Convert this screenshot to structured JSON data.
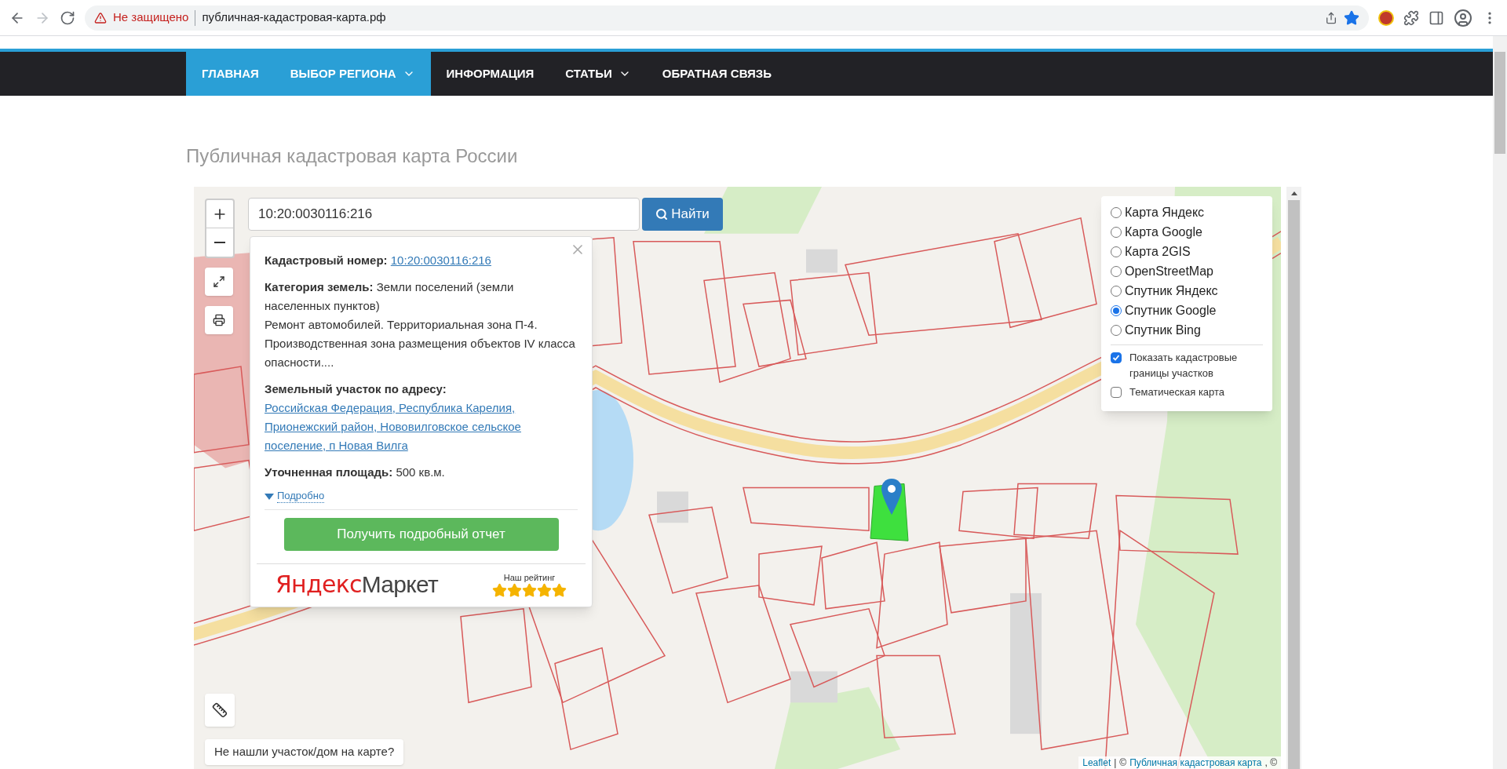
{
  "browser": {
    "security_label": "Не защищено",
    "url": "публичная-кадастровая-карта.рф",
    "bookmarked": true
  },
  "nav": [
    {
      "label": "ГЛАВНАЯ",
      "highlighted": true,
      "dropdown": false
    },
    {
      "label": "ВЫБОР РЕГИОНА",
      "highlighted": true,
      "dropdown": true
    },
    {
      "label": "ИНФОРМАЦИЯ",
      "highlighted": false,
      "dropdown": false
    },
    {
      "label": "СТАТЬИ",
      "highlighted": false,
      "dropdown": true
    },
    {
      "label": "ОБРАТНАЯ СВЯЗЬ",
      "highlighted": false,
      "dropdown": false
    }
  ],
  "page_title": "Публичная кадастровая карта России",
  "map": {
    "search": {
      "value": "10:20:0030116:216",
      "button": "Найти"
    },
    "popup": {
      "cadastral_label": "Кадастровый номер:",
      "cadastral_link": "10:20:0030116:216",
      "category": "**Категория земель:** Земли поселений (земли населенных пунктов)",
      "description": "Ремонт автомобилей. Территориальная зона П-4. Производственная зона размещения объектов IV класса опасности....",
      "address_label": "Земельный участок по адресу:",
      "address_link": "Российская Федерация, Республика Карелия, Прионежский район, Нововилговское сельское поселение, п Новая Вилга",
      "area": "**Уточненная площадь:** 500 кв.м.",
      "details": {
        "label": "Подробно",
        "expanded": false
      },
      "report_button": "Получить подробный отчет",
      "logo": {
        "part_1": "Яндекс",
        "part_2": "Маркет"
      },
      "rating": {
        "label": "Наш рейтинг",
        "stars": 5
      }
    },
    "layers": [
      {
        "label": "Карта Яндекс",
        "selected": false
      },
      {
        "label": "Карта Google",
        "selected": false
      },
      {
        "label": "Карта 2GIS",
        "selected": false
      },
      {
        "label": "OpenStreetMap",
        "selected": false
      },
      {
        "label": "Спутник Яндекс",
        "selected": false
      },
      {
        "label": "Спутник Google",
        "selected": true
      },
      {
        "label": "Спутник Bing",
        "selected": false
      }
    ],
    "overlays": [
      {
        "label": "Показать кадастровые границы участков",
        "checked": true
      },
      {
        "label": "Тематическая карта",
        "checked": false
      }
    ],
    "not_found": "Не нашли участок/дом на карте?",
    "attribution": {
      "link_1": "Leaflet",
      "separator": "|",
      "copyright": "©",
      "link_2": "Публичная кадастровая карта",
      "tail": ", ©"
    }
  }
}
